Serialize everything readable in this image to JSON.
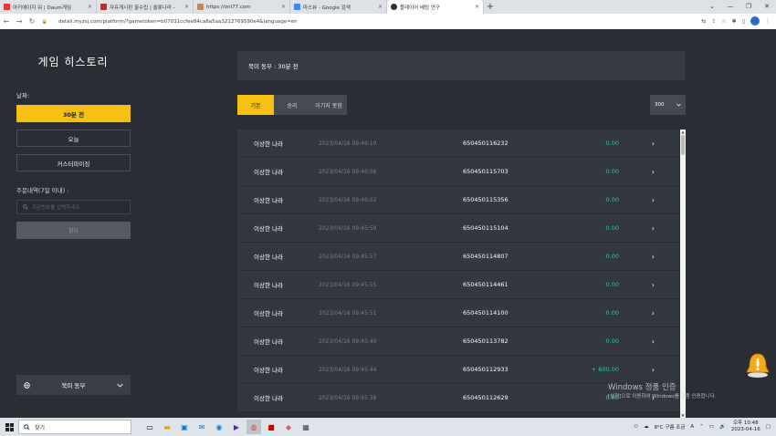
{
  "browser": {
    "tabs": [
      {
        "title": "아키에이지 워 | Daum게임",
        "active": false
      },
      {
        "title": "자유게시판 꿀수립 | 쏠롯나라 -",
        "active": false
      },
      {
        "title": "https://oni77.com",
        "active": false
      },
      {
        "title": "마스뷰 - Google 검색",
        "active": false
      },
      {
        "title": "플레이어 베팅 연구",
        "active": true
      }
    ],
    "new_tab": "+",
    "url": "detail.myzsj.com/platform/?gametoken=b07031ccfee84ca6a5aa3212769590e4&language=en",
    "profile": "KE"
  },
  "sidebar": {
    "title": "게임 히스토리",
    "date_label": "날짜:",
    "date_buttons": [
      {
        "label": "30분 전",
        "active": true
      },
      {
        "label": "오늘",
        "active": false
      },
      {
        "label": "커스터마이징",
        "active": false
      }
    ],
    "order_label": "주문내역(7일 이내) :",
    "order_placeholder": "주문번호를 입력하세요",
    "search_label": "찾다",
    "region_label": "북미 동부"
  },
  "main": {
    "header": "북미 동부 : 30분 전",
    "filters": [
      {
        "label": "기본",
        "active": true
      },
      {
        "label": "승리",
        "active": false
      },
      {
        "label": "이기지 못함",
        "active": false
      }
    ],
    "page_size": "300",
    "rows": [
      {
        "name": "이상한 나라",
        "time": "2023/04/16 09:46:10",
        "id": "650450116232",
        "amount": "0.00"
      },
      {
        "name": "이상한 나라",
        "time": "2023/04/16 09:46:06",
        "id": "650450115703",
        "amount": "0.00"
      },
      {
        "name": "이상한 나라",
        "time": "2023/04/16 09:46:02",
        "id": "650450115356",
        "amount": "0.00"
      },
      {
        "name": "이상한 나라",
        "time": "2023/04/16 09:45:58",
        "id": "650450115104",
        "amount": "0.00"
      },
      {
        "name": "이상한 나라",
        "time": "2023/04/16 09:45:57",
        "id": "650450114807",
        "amount": "0.00"
      },
      {
        "name": "이상한 나라",
        "time": "2023/04/16 09:45:55",
        "id": "650450114461",
        "amount": "0.00"
      },
      {
        "name": "이상한 나라",
        "time": "2023/04/16 09:45:51",
        "id": "650450114100",
        "amount": "0.00"
      },
      {
        "name": "이상한 나라",
        "time": "2023/04/16 09:45:49",
        "id": "650450113782",
        "amount": "0.00"
      },
      {
        "name": "이상한 나라",
        "time": "2023/04/16 09:45:44",
        "id": "650450112933",
        "amount": "+ 600.00"
      },
      {
        "name": "이상한 나라",
        "time": "2023/04/16 09:45:38",
        "id": "650450112629",
        "amount": "0.00"
      }
    ]
  },
  "overlay": {
    "watermark_title": "Windows 정품 인증",
    "watermark_sub": "[설정]으로 이동하여 Windows를 정품 인증합니다."
  },
  "taskbar": {
    "search_label": "찾기",
    "weather": "8°C 구름 조금",
    "time": "오후 10:48",
    "date": "2023-04-16",
    "lang": "A"
  },
  "colors": {
    "accent": "#f6c012",
    "win_green": "#3cc3a4"
  }
}
